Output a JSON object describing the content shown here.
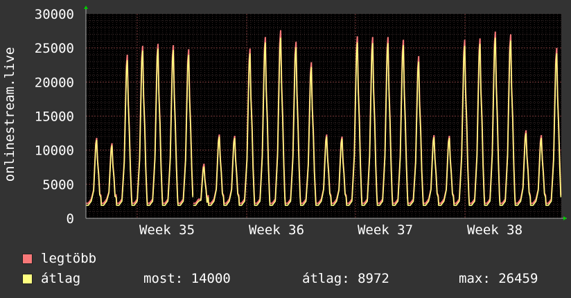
{
  "chart_data": {
    "type": "line",
    "ylabel": "onlinestream.live",
    "yticks": [
      0,
      5000,
      10000,
      15000,
      20000,
      25000,
      30000
    ],
    "ylim": [
      0,
      30000
    ],
    "xticks": [
      "Week 35",
      "Week 36",
      "Week 37",
      "Week 38"
    ],
    "grid": true,
    "legend_position": "bottom-left",
    "series": [
      {
        "name": "legtöbb",
        "color": "#f87878",
        "daily_peaks": [
          11800,
          11000,
          24000,
          25300,
          25600,
          25400,
          24800,
          8000,
          12300,
          12100,
          24900,
          26600,
          27600,
          25900,
          22900,
          12300,
          12000,
          26700,
          26600,
          26600,
          26200,
          23800,
          12200,
          12100,
          26200,
          26400,
          27400,
          27000,
          12900,
          12200,
          25000
        ]
      },
      {
        "name": "átlag",
        "color": "#ffff80",
        "daily_peaks": [
          11500,
          10700,
          23200,
          24600,
          24900,
          24700,
          24000,
          7600,
          12000,
          11800,
          24200,
          25800,
          26500,
          25100,
          22200,
          12000,
          11700,
          25800,
          25700,
          25700,
          25400,
          23000,
          11900,
          11800,
          25300,
          25600,
          26500,
          26100,
          12500,
          11800,
          24200
        ]
      }
    ]
  },
  "legend": [
    {
      "label": "legtöbb",
      "color": "#f87878"
    },
    {
      "label": "átlag",
      "color": "#ffff80"
    }
  ],
  "stats": {
    "now": "most: 14000",
    "avg": "átlag: 8972",
    "max": "max: 26459"
  }
}
